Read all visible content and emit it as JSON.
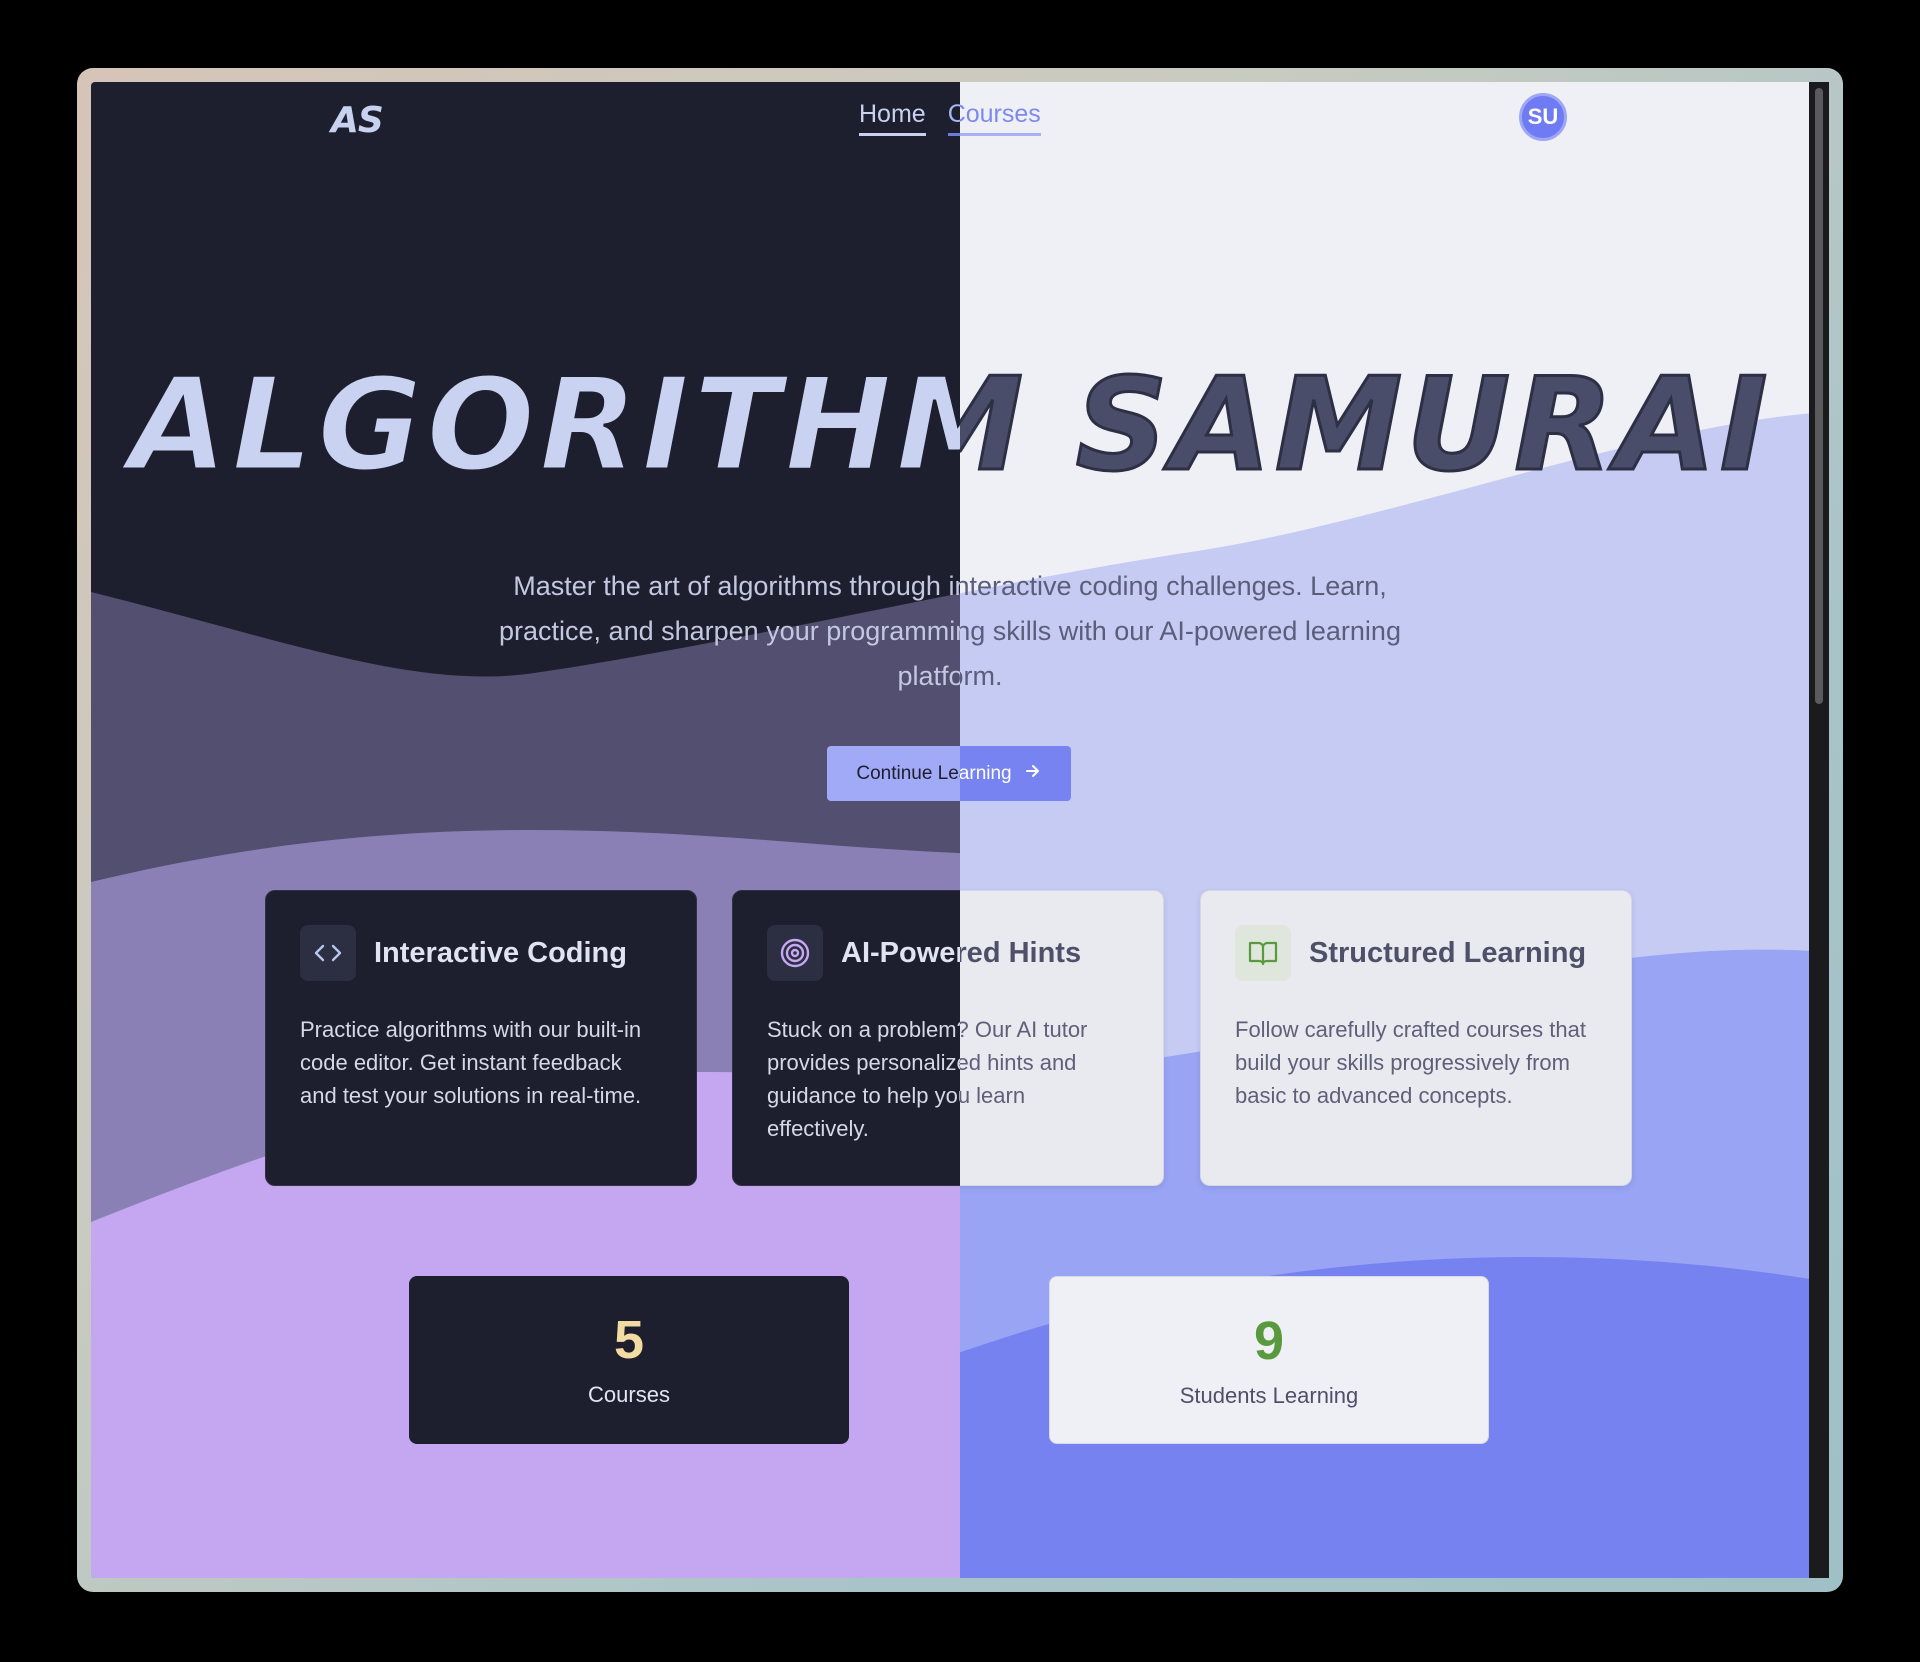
{
  "logo": "AS",
  "nav": {
    "items": [
      {
        "label": "Home"
      },
      {
        "label": "Courses"
      }
    ]
  },
  "user": {
    "initials": "SU"
  },
  "hero": {
    "title": "ALGORITHM SAMURAI",
    "subtitle": "Master the art of algorithms through interactive coding challenges. Learn, practice, and sharpen your programming skills with our AI-powered learning platform.",
    "cta_label": "Continue Learning",
    "cta_icon": "arrow-right-icon"
  },
  "features": [
    {
      "icon": "code-brackets-icon",
      "title": "Interactive Coding",
      "text": "Practice algorithms with our built-in code editor. Get instant feedback and test your solutions in real-time."
    },
    {
      "icon": "target-icon",
      "title": "AI-Powered Hints",
      "text": "Stuck on a problem? Our AI tutor provides personalized hints and guidance to help you learn effectively."
    },
    {
      "icon": "open-book-icon",
      "title": "Structured Learning",
      "text": "Follow carefully crafted courses that build your skills progressively from basic to advanced concepts."
    }
  ],
  "stats": [
    {
      "value": "5",
      "label": "Courses"
    },
    {
      "value": "9",
      "label": "Students Learning"
    }
  ],
  "theme_colors": {
    "dark_bg": "#1e1f2e",
    "light_bg": "#eff0f5",
    "accent": "#7783f1",
    "stat_green": "#5a9a3e",
    "stat_gold": "#f3dca3"
  }
}
